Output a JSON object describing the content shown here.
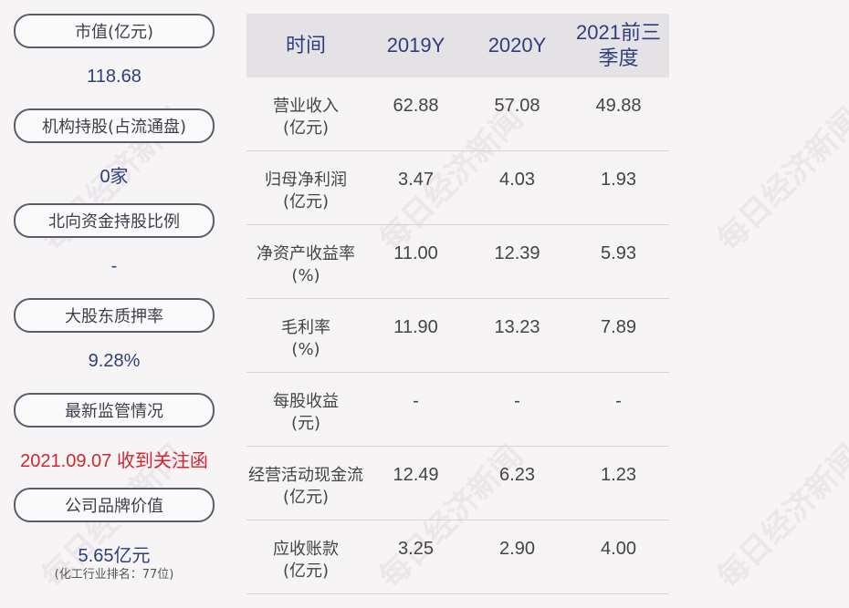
{
  "watermark": "每日经济新闻",
  "left": {
    "items": [
      {
        "label": "市值(亿元)",
        "value": "118.68"
      },
      {
        "label": "机构持股(占流通盘)",
        "value": "0家"
      },
      {
        "label": "北向资金持股比例",
        "value": "-"
      },
      {
        "label": "大股东质押率",
        "value": "9.28%"
      },
      {
        "label": "最新监管情况",
        "value": "2021.09.07 收到关注函"
      },
      {
        "label": "公司品牌价值",
        "value": "5.65亿元",
        "sub": "(化工行业排名：77位)"
      }
    ]
  },
  "table": {
    "headers": [
      "时间",
      "2019Y",
      "2020Y",
      "2021前三\n季度"
    ],
    "rows": [
      {
        "label1": "营业收入",
        "label2": "(亿元)",
        "v": [
          "62.88",
          "57.08",
          "49.88"
        ]
      },
      {
        "label1": "归母净利润",
        "label2": "(亿元)",
        "v": [
          "3.47",
          "4.03",
          "1.93"
        ]
      },
      {
        "label1": "净资产收益率",
        "label2": "(%)",
        "v": [
          "11.00",
          "12.39",
          "5.93"
        ]
      },
      {
        "label1": "毛利率",
        "label2": "(%)",
        "v": [
          "11.90",
          "13.23",
          "7.89"
        ]
      },
      {
        "label1": "每股收益",
        "label2": "(元)",
        "v": [
          "-",
          "-",
          "-"
        ]
      },
      {
        "label1": "经营活动现金流",
        "label2": "(亿元)",
        "v": [
          "12.49",
          "6.23",
          "1.23"
        ]
      },
      {
        "label1": "应收账款",
        "label2": "(亿元)",
        "v": [
          "3.25",
          "2.90",
          "4.00"
        ]
      }
    ]
  }
}
